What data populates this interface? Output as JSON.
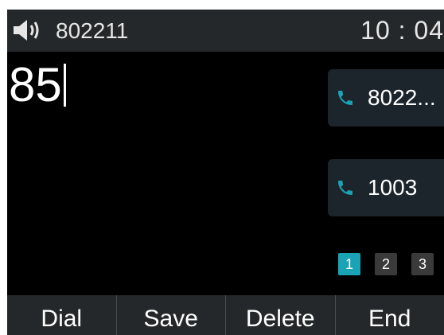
{
  "status_bar": {
    "speaker_icon": "speaker-volume-icon",
    "account": "802211",
    "time": "10 : 04"
  },
  "dial": {
    "digits": "85"
  },
  "contacts": [
    {
      "icon": "phone-icon",
      "label": "8022..."
    },
    {
      "icon": "phone-icon",
      "label": "1003"
    }
  ],
  "pager": {
    "pages": [
      "1",
      "2",
      "3"
    ],
    "active": "1"
  },
  "softkeys": {
    "dial": "Dial",
    "save": "Save",
    "delete": "Delete",
    "end": "End"
  },
  "colors": {
    "accent": "#1aa3b5",
    "bar": "#25282a",
    "screen": "#000000",
    "contact_bg": "#1c252c"
  }
}
